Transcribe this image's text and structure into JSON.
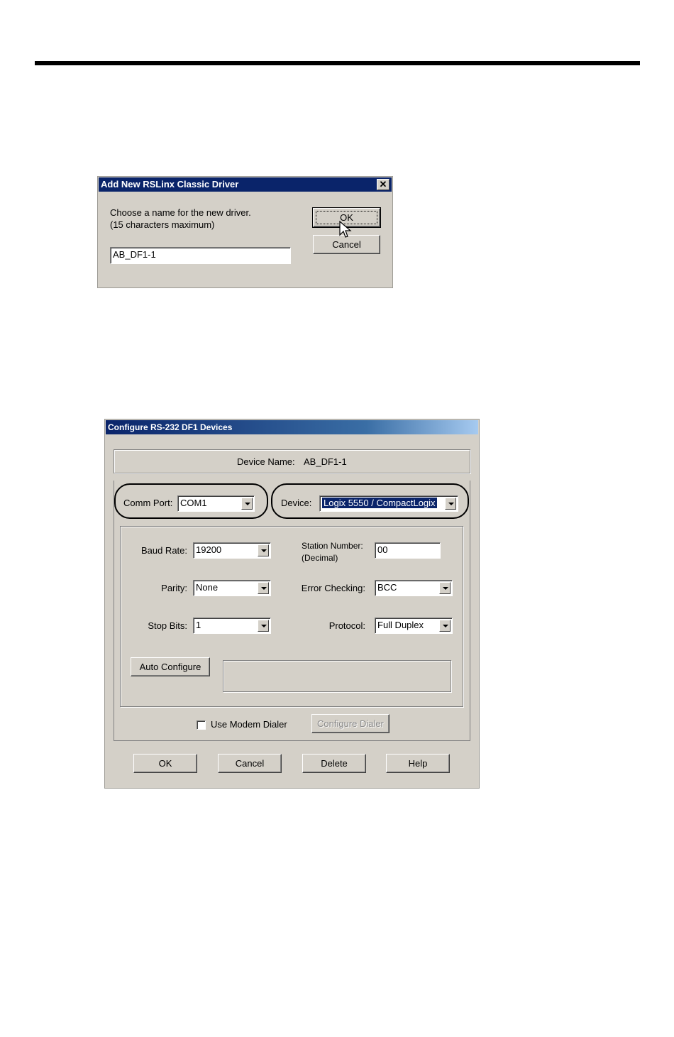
{
  "dialog1": {
    "title": "Add New RSLinx Classic Driver",
    "prompt_line1": "Choose a name for the new driver.",
    "prompt_line2": "(15 characters maximum)",
    "name_value": "AB_DF1-1",
    "ok_label": "OK",
    "cancel_label": "Cancel",
    "close_glyph": "✕"
  },
  "dialog2": {
    "title": "Configure RS-232 DF1 Devices",
    "device_name_label": "Device Name:",
    "device_name_value": "AB_DF1-1",
    "comm_port_label": "Comm Port:",
    "comm_port_value": "COM1",
    "device_label": "Device:",
    "device_value": "Logix 5550 / CompactLogix",
    "baud_rate_label": "Baud Rate:",
    "baud_rate_value": "19200",
    "station_number_label_1": "Station Number:",
    "station_number_label_2": "(Decimal)",
    "station_number_value": "00",
    "parity_label": "Parity:",
    "parity_value": "None",
    "error_checking_label": "Error Checking:",
    "error_checking_value": "BCC",
    "stop_bits_label": "Stop Bits:",
    "stop_bits_value": "1",
    "protocol_label": "Protocol:",
    "protocol_value": "Full Duplex",
    "auto_configure_label": "Auto Configure",
    "use_modem_dialer_label": "Use Modem Dialer",
    "use_modem_dialer_checked": false,
    "configure_dialer_label": "Configure Dialer",
    "ok_label": "OK",
    "cancel_label": "Cancel",
    "delete_label": "Delete",
    "help_label": "Help"
  },
  "colors": {
    "dialog_face": "#d4d0c8",
    "title_active": "#0a246a",
    "selection": "#0a246a"
  }
}
